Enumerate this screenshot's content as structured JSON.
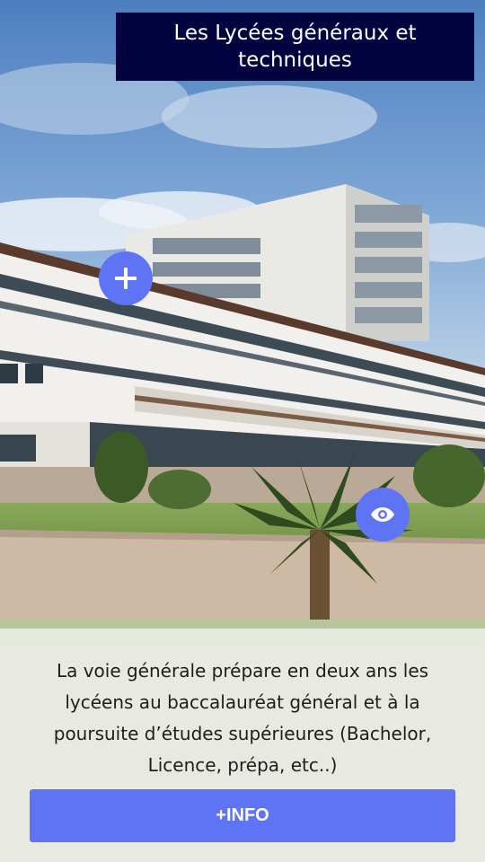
{
  "header": {
    "title": "Les Lycées généraux et techniques"
  },
  "hotspots": {
    "plus_icon": "plus-icon",
    "eye_icon": "eye-icon"
  },
  "content": {
    "description": "La voie générale prépare en deux ans les lycéens au baccalauréat général et à la poursuite d’études supérieures (Bachelor, Licence, prépa, etc..)"
  },
  "actions": {
    "info_label": "+INFO"
  },
  "colors": {
    "accent": "#5f73f5",
    "title_background": "#02033f",
    "title_text": "#ffffff"
  }
}
